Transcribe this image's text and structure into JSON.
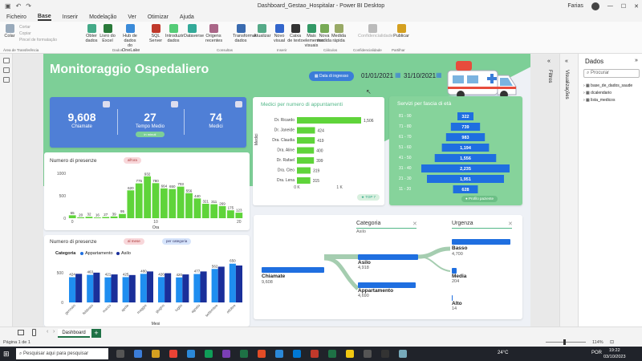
{
  "window": {
    "title": "Dashboard_Gestao_Hospitalar - Power BI Desktop",
    "user": "Farias"
  },
  "ribbon_tabs": [
    "Ficheiro",
    "Base",
    "Inserir",
    "Modelação",
    "Ver",
    "Otimizar",
    "Ajuda"
  ],
  "ribbon_items": [
    {
      "label": "Colar",
      "color": "#9ab"
    },
    {
      "label": "Obter dados",
      "color": "#4a8"
    },
    {
      "label": "Livro do Excel",
      "color": "#2a7a3a"
    },
    {
      "label": "Hub de dados do OneLake",
      "color": "#3b8bd9"
    },
    {
      "label": "SQL Server",
      "color": "#c0392b"
    },
    {
      "label": "Introduzir dados",
      "color": "#5c7"
    },
    {
      "label": "Dataverse",
      "color": "#3a9"
    },
    {
      "label": "Origens recentes",
      "color": "#a68"
    },
    {
      "label": "Transformar dados",
      "color": "#3a6bb0"
    },
    {
      "label": "Atualizar",
      "color": "#5a8"
    },
    {
      "label": "Novo visual",
      "color": "#36c"
    },
    {
      "label": "Caixa de texto",
      "color": "#333"
    },
    {
      "label": "Mais elementos visuais",
      "color": "#396"
    },
    {
      "label": "Nova medida",
      "color": "#7a5"
    },
    {
      "label": "Medida rápida",
      "color": "#9a6"
    },
    {
      "label": "Confidencialidade",
      "color": "#bbb"
    },
    {
      "label": "Publicar",
      "color": "#d4a020"
    }
  ],
  "clipboard_items": [
    "Cortar",
    "Copiar",
    "Pincel de formatação"
  ],
  "ribbon_groups": [
    "Área de Transferência",
    "Dados",
    "Consultas",
    "Inserir",
    "Cálculos",
    "Confidencialidade",
    "Partilhar"
  ],
  "dashboard": {
    "title": "Monitoraggio  Ospedaliero",
    "date_button": "Data di ingresso",
    "date_from": "01/01/2021",
    "date_to": "31/10/2021",
    "kpis": [
      {
        "value": "9,608",
        "label": "Chiamate"
      },
      {
        "value": "27",
        "label": "Tempo Medio"
      },
      {
        "value": "74",
        "label": "Medici"
      }
    ],
    "kpi_badge": "in minuti",
    "presence_title": "Numero di presenze",
    "presence_filter": "all'ora",
    "presence_axis_label": "Ora",
    "presence_data": [
      65,
      20,
      32,
      16,
      27,
      39,
      95,
      620,
      775,
      932,
      780,
      664,
      650,
      703,
      556,
      440,
      321,
      311,
      269,
      175,
      123
    ],
    "presence_labels": [
      "65",
      "20",
      "32",
      "16",
      "27",
      "39",
      "95",
      "620",
      "775",
      "932",
      "780",
      "664",
      "650",
      "703",
      "556",
      "440",
      "321",
      "311",
      "269",
      "175",
      "123"
    ],
    "presence_xticks": [
      "0",
      "10",
      "20"
    ],
    "presence_yticks": [
      "1000",
      "500",
      "0"
    ],
    "month_title": "Numero di presenze",
    "month_filter1": "al mese",
    "month_filter2": "per categoria",
    "month_legend_label": "Categoria",
    "month_legend": [
      "Appartamento",
      "Asilo"
    ],
    "month_axis_label": "Mesi",
    "months": [
      "gennaio",
      "febbraio",
      "marzo",
      "aprile",
      "maggio",
      "giugno",
      "luglio",
      "agosto",
      "settembre",
      "ottobre"
    ],
    "month_apt_labels": [
      "424",
      "463",
      "421",
      "425",
      "480",
      "426",
      "420",
      "477",
      "562",
      "650"
    ],
    "month_apt": [
      424,
      463,
      421,
      425,
      480,
      426,
      420,
      477,
      562,
      650
    ],
    "month_asilo": [
      480,
      500,
      470,
      460,
      520,
      490,
      470,
      520,
      600,
      620
    ],
    "month_yticks": [
      "500",
      "0"
    ],
    "doctors_title": "Medici per numero di appuntamenti",
    "doctors_axis_label": "Medici",
    "doctors": [
      {
        "name": "Dr. Ricardo",
        "value": 1506,
        "label": "1,506"
      },
      {
        "name": "Dr. Janeide",
        "value": 424,
        "label": "424"
      },
      {
        "name": "Dra. Claudia",
        "value": 419,
        "label": "419"
      },
      {
        "name": "Dra. Aline",
        "value": 400,
        "label": "400"
      },
      {
        "name": "Dr. Rafael",
        "value": 399,
        "label": "399"
      },
      {
        "name": "Dra. Cleo",
        "value": 319,
        "label": "319"
      },
      {
        "name": "Dra. Lena",
        "value": 315,
        "label": "315"
      }
    ],
    "doctors_xticks": [
      "0 K",
      "1 K"
    ],
    "doctors_badge": "TOP 7",
    "age_title": "Servizi per fascia di età",
    "age_groups": [
      {
        "band": "81 - 90",
        "value": 322,
        "label": "322"
      },
      {
        "band": "71 - 80",
        "value": 739,
        "label": "739"
      },
      {
        "band": "61 - 70",
        "value": 983,
        "label": "983"
      },
      {
        "band": "51 - 60",
        "value": 1194,
        "label": "1,194"
      },
      {
        "band": "41 - 50",
        "value": 1556,
        "label": "1,556"
      },
      {
        "band": "31 - 40",
        "value": 2235,
        "label": "2,235"
      },
      {
        "band": "21 - 30",
        "value": 1951,
        "label": "1,951"
      },
      {
        "band": "11 - 20",
        "value": 628,
        "label": "628"
      }
    ],
    "age_badge": "Profilo paziente",
    "decomp": {
      "col1_title": "Categoria",
      "col1_sub": "Asilo",
      "col2_title": "Urgenza",
      "root": {
        "label": "Chiamate",
        "value": "9,608"
      },
      "level1": [
        {
          "label": "Asilo",
          "value": "4,918"
        },
        {
          "label": "Appartamento",
          "value": "4,690"
        }
      ],
      "level2": [
        {
          "label": "Basso",
          "value": "4,700"
        },
        {
          "label": "Media",
          "value": "204"
        },
        {
          "label": "Alto",
          "value": "14"
        }
      ]
    }
  },
  "viz_pane": {
    "label1": "Visualizações",
    "label2": "Filtros"
  },
  "data_pane": {
    "title": "Dados",
    "search_placeholder": "Procurar",
    "tables": [
      "base_de_dados_saude",
      "dcalendario",
      "lista_medicos"
    ]
  },
  "pages": {
    "current": "Dashboard",
    "add": "+"
  },
  "status": {
    "page": "Página 1 de 1",
    "zoom": "114%"
  },
  "taskbar": {
    "search": "Pesquisar aqui para pesquisar",
    "temp": "24°C",
    "lang": "POR",
    "time": "19:22",
    "date": "03/10/2023"
  },
  "colors": {
    "green": "#52b788",
    "bar_green": "#5fd43a",
    "blue": "#1f6fe0",
    "dark_blue": "#1a2f9a",
    "kpi_blue": "#4f7fd6"
  }
}
